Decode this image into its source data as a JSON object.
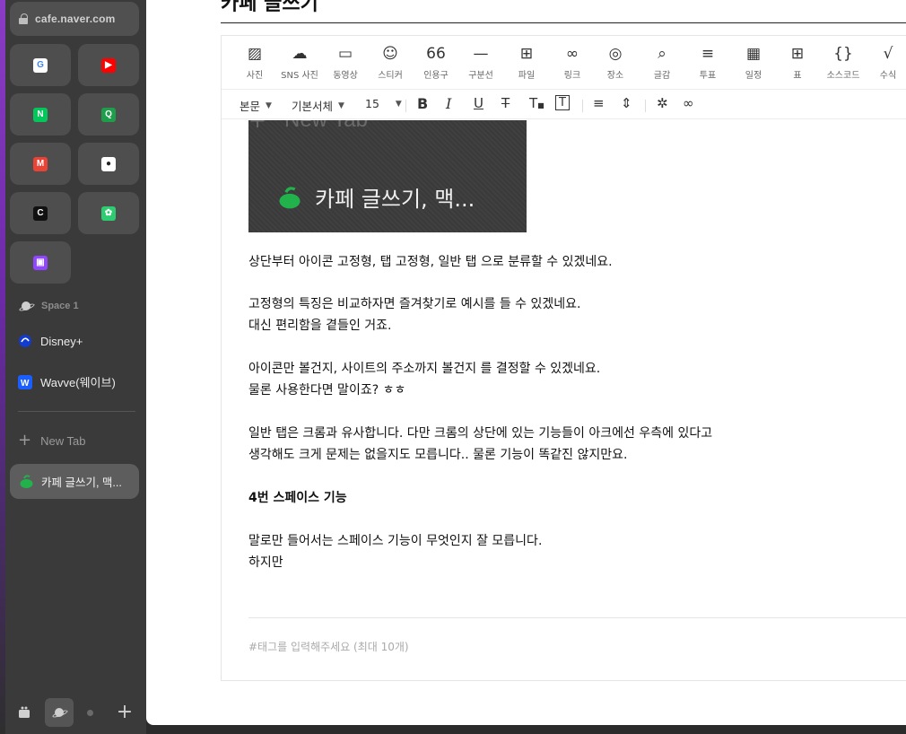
{
  "sidebar": {
    "url": "cafe.naver.com",
    "favorites": [
      {
        "name": "google",
        "letter": "G",
        "bg": "#ffffff",
        "fg": "#4285F4"
      },
      {
        "name": "youtube",
        "letter": "▶",
        "bg": "#ff0000",
        "fg": "#ffffff"
      },
      {
        "name": "naver",
        "letter": "N",
        "bg": "#03c75a",
        "fg": "#ffffff"
      },
      {
        "name": "naver-search",
        "letter": "Q",
        "bg": "#1e9e4a",
        "fg": "#ffffff"
      },
      {
        "name": "gmail",
        "letter": "M",
        "bg": "#ea4335",
        "fg": "#ffffff"
      },
      {
        "name": "github",
        "letter": "●",
        "bg": "#ffffff",
        "fg": "#222222"
      },
      {
        "name": "c-app",
        "letter": "C",
        "bg": "#111111",
        "fg": "#ffffff"
      },
      {
        "name": "leaf-app",
        "letter": "✿",
        "bg": "#2ecc71",
        "fg": "#ffffff"
      },
      {
        "name": "twitch",
        "letter": "▣",
        "bg": "#9146ff",
        "fg": "#ffffff"
      }
    ],
    "space_label": "Space 1",
    "pinned_tabs": [
      {
        "label": "Disney+",
        "icon": "disney-icon"
      },
      {
        "label": "Wavve(웨이브)",
        "icon": "wavve-icon"
      }
    ],
    "new_tab_label": "New Tab",
    "active_tab_label": "카페 글쓰기, 맥..."
  },
  "content": {
    "page_title": "카페 글쓰기",
    "toolbar": [
      {
        "label": "사진",
        "glyph": "▨"
      },
      {
        "label": "SNS 사진",
        "glyph": "☁"
      },
      {
        "label": "동영상",
        "glyph": "▭"
      },
      {
        "label": "스티커",
        "glyph": "☺"
      },
      {
        "label": "인용구",
        "glyph": "66"
      },
      {
        "label": "구분선",
        "glyph": "—"
      },
      {
        "label": "파일",
        "glyph": "⊞"
      },
      {
        "label": "링크",
        "glyph": "∞"
      },
      {
        "label": "장소",
        "glyph": "◎"
      },
      {
        "label": "글감",
        "glyph": "⌕"
      },
      {
        "label": "투표",
        "glyph": "≡"
      },
      {
        "label": "일정",
        "glyph": "▦"
      },
      {
        "label": "표",
        "glyph": "⊞"
      },
      {
        "label": "소스코드",
        "glyph": "{}"
      },
      {
        "label": "수식",
        "glyph": "√"
      }
    ],
    "format": {
      "style": "본문",
      "font": "기본서체",
      "size": "15"
    },
    "image": {
      "top_text": "New Tab",
      "caption": "카페 글쓰기, 맥..."
    },
    "paragraphs": [
      {
        "text": "상단부터 아이콘 고정형, 탭 고정형, 일반 탭 으로 분류할 수 있겠네요.",
        "bold": false
      },
      {
        "text": "고정형의 특징은 비교하자면 즐겨찾기로 예시를 들 수 있겠네요.",
        "bold": false
      },
      {
        "text": "대신 편리함을 곁들인 거죠.",
        "bold": false
      },
      {
        "text": "아이콘만 볼건지, 사이트의 주소까지 볼건지 를 결정할 수 있겠네요.",
        "bold": false
      },
      {
        "text": "물론 사용한다면 말이죠? ㅎㅎ",
        "bold": false
      },
      {
        "text": "일반 탭은 크롬과 유사합니다. 다만 크롬의 상단에 있는 기능들이 아크에선 우측에 있다고",
        "bold": false
      },
      {
        "text": "생각해도 크게 문제는 없을지도 모릅니다.. 물론 기능이 똑같진 않지만요.",
        "bold": false
      },
      {
        "text": "4번 스페이스 기능",
        "bold": true
      },
      {
        "text": "말로만 들어서는 스페이스 기능이 무엇인지 잘 모릅니다.",
        "bold": false
      },
      {
        "text": "하지만",
        "bold": false
      }
    ],
    "tag_placeholder": "#태그를 입력해주세요 (최대 10개)"
  }
}
